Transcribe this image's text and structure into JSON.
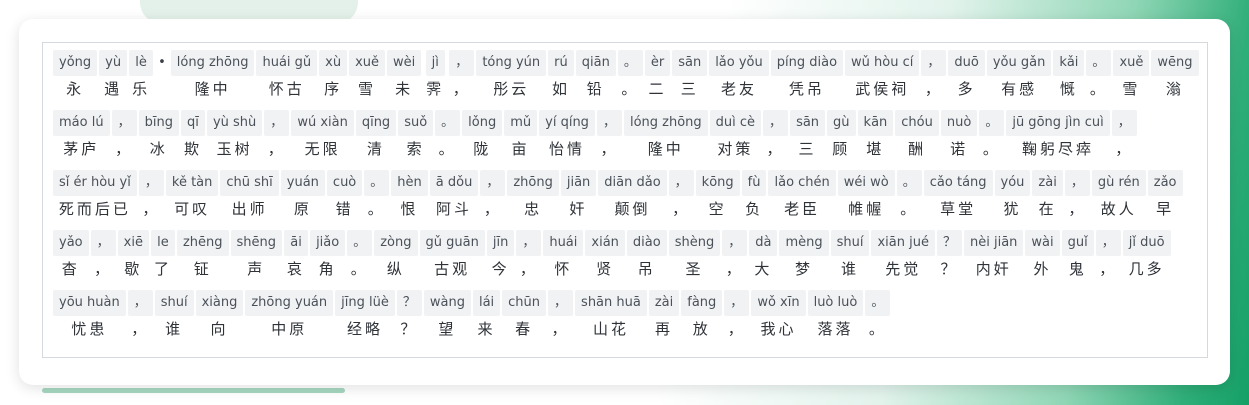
{
  "units": [
    {
      "py": "yǒng",
      "hz": "永"
    },
    {
      "py": "yù",
      "hz": "遇"
    },
    {
      "py": "lè",
      "hz": "乐"
    },
    {
      "py": "•",
      "hz": ""
    },
    {
      "py": "lóng zhōng",
      "hz": "隆中"
    },
    {
      "py": "huái gǔ",
      "hz": "怀古"
    },
    {
      "py": "xù",
      "hz": "序"
    },
    {
      "py": "xuě",
      "hz": "雪"
    },
    {
      "py": "wèi",
      "hz": "未"
    },
    {
      "py": "jì",
      "hz": "霁"
    },
    {
      "py": "，",
      "hz": "，"
    },
    {
      "py": "tóng yún",
      "hz": "彤云"
    },
    {
      "py": "rú",
      "hz": "如"
    },
    {
      "py": "qiān",
      "hz": "铅"
    },
    {
      "py": "。",
      "hz": "。"
    },
    {
      "py": "èr",
      "hz": "二"
    },
    {
      "py": "sān",
      "hz": "三"
    },
    {
      "py": "lǎo yǒu",
      "hz": "老友"
    },
    {
      "py": "píng diào",
      "hz": "凭吊"
    },
    {
      "py": "wǔ hòu cí",
      "hz": "武侯祠"
    },
    {
      "py": "，",
      "hz": "，"
    },
    {
      "py": "duō",
      "hz": "多"
    },
    {
      "py": "yǒu gǎn",
      "hz": "有感"
    },
    {
      "py": "kǎi",
      "hz": "慨"
    },
    {
      "py": "。",
      "hz": "。"
    },
    {
      "py": "xuě",
      "hz": "雪"
    },
    {
      "py": "wēng",
      "hz": "滃"
    },
    {
      "py": "máo lú",
      "hz": "茅庐"
    },
    {
      "py": "，",
      "hz": "，"
    },
    {
      "py": "bīng",
      "hz": "冰"
    },
    {
      "py": "qī",
      "hz": "欺"
    },
    {
      "py": "yù shù",
      "hz": "玉树"
    },
    {
      "py": "，",
      "hz": "，"
    },
    {
      "py": "wú xiàn",
      "hz": "无限"
    },
    {
      "py": "qīng",
      "hz": "清"
    },
    {
      "py": "suǒ",
      "hz": "索"
    },
    {
      "py": "。",
      "hz": "。"
    },
    {
      "py": "lǒng",
      "hz": "陇"
    },
    {
      "py": "mǔ",
      "hz": "亩"
    },
    {
      "py": "yí qíng",
      "hz": "怡情"
    },
    {
      "py": "，",
      "hz": "，"
    },
    {
      "py": "lóng zhōng",
      "hz": "隆中"
    },
    {
      "py": "duì cè",
      "hz": "对策"
    },
    {
      "py": "，",
      "hz": "，"
    },
    {
      "py": "sān",
      "hz": "三"
    },
    {
      "py": "gù",
      "hz": "顾"
    },
    {
      "py": "kān",
      "hz": "堪"
    },
    {
      "py": "chóu",
      "hz": "酬"
    },
    {
      "py": "nuò",
      "hz": "诺"
    },
    {
      "py": "。",
      "hz": "。"
    },
    {
      "py": "jū gōng jìn cuì",
      "hz": "鞠躬尽瘁"
    },
    {
      "py": "，",
      "hz": "，"
    },
    {
      "py": "sǐ ér hòu yǐ",
      "hz": "死而后已"
    },
    {
      "py": "，",
      "hz": "，"
    },
    {
      "py": "kě tàn",
      "hz": "可叹"
    },
    {
      "py": "chū shī",
      "hz": "出师"
    },
    {
      "py": "yuán",
      "hz": "原"
    },
    {
      "py": "cuò",
      "hz": "错"
    },
    {
      "py": "。",
      "hz": "。"
    },
    {
      "py": "hèn",
      "hz": "恨"
    },
    {
      "py": "ā dǒu",
      "hz": "阿斗"
    },
    {
      "py": "，",
      "hz": "，"
    },
    {
      "py": "zhōng",
      "hz": "忠"
    },
    {
      "py": "jiān",
      "hz": "奸"
    },
    {
      "py": "diān dǎo",
      "hz": "颠倒"
    },
    {
      "py": "，",
      "hz": "，"
    },
    {
      "py": "kōng",
      "hz": "空"
    },
    {
      "py": "fù",
      "hz": "负"
    },
    {
      "py": "lǎo chén",
      "hz": "老臣"
    },
    {
      "py": "wéi wò",
      "hz": "帷幄"
    },
    {
      "py": "。",
      "hz": "。"
    },
    {
      "py": "cǎo táng",
      "hz": "草堂"
    },
    {
      "py": "yóu",
      "hz": "犹"
    },
    {
      "py": "zài",
      "hz": "在"
    },
    {
      "py": "，",
      "hz": "，"
    },
    {
      "py": "gù rén",
      "hz": "故人"
    },
    {
      "py": "zǎo",
      "hz": "早"
    },
    {
      "py": "yǎo",
      "hz": "杳"
    },
    {
      "py": "，",
      "hz": "，"
    },
    {
      "py": "xiē",
      "hz": "歇"
    },
    {
      "py": "le",
      "hz": "了"
    },
    {
      "py": "zhēng",
      "hz": "钲"
    },
    {
      "py": "shēng",
      "hz": "声"
    },
    {
      "py": "āi",
      "hz": "哀"
    },
    {
      "py": "jiǎo",
      "hz": "角"
    },
    {
      "py": "。",
      "hz": "。"
    },
    {
      "py": "zòng",
      "hz": "纵"
    },
    {
      "py": "gǔ guān",
      "hz": "古观"
    },
    {
      "py": "jīn",
      "hz": "今"
    },
    {
      "py": "，",
      "hz": "，"
    },
    {
      "py": "huái",
      "hz": "怀"
    },
    {
      "py": "xián",
      "hz": "贤"
    },
    {
      "py": "diào",
      "hz": "吊"
    },
    {
      "py": "shèng",
      "hz": "圣"
    },
    {
      "py": "，",
      "hz": "，"
    },
    {
      "py": "dà",
      "hz": "大"
    },
    {
      "py": "mèng",
      "hz": "梦"
    },
    {
      "py": "shuí",
      "hz": "谁"
    },
    {
      "py": "xiān jué",
      "hz": "先觉"
    },
    {
      "py": "？",
      "hz": "？"
    },
    {
      "py": "nèi jiān",
      "hz": "内奸"
    },
    {
      "py": "wài",
      "hz": "外"
    },
    {
      "py": "guǐ",
      "hz": "鬼"
    },
    {
      "py": "，",
      "hz": "，"
    },
    {
      "py": "jǐ duō",
      "hz": "几多"
    },
    {
      "py": "yōu huàn",
      "hz": "忧患"
    },
    {
      "py": "，",
      "hz": "，"
    },
    {
      "py": "shuí",
      "hz": "谁"
    },
    {
      "py": "xiàng",
      "hz": "向"
    },
    {
      "py": "zhōng yuán",
      "hz": "中原"
    },
    {
      "py": "jīng lüè",
      "hz": "经略"
    },
    {
      "py": "？",
      "hz": "？"
    },
    {
      "py": "wàng",
      "hz": "望"
    },
    {
      "py": "lái",
      "hz": "来"
    },
    {
      "py": "chūn",
      "hz": "春"
    },
    {
      "py": "，",
      "hz": "，"
    },
    {
      "py": "shān huā",
      "hz": "山花"
    },
    {
      "py": "zài",
      "hz": "再"
    },
    {
      "py": "fàng",
      "hz": "放"
    },
    {
      "py": "，",
      "hz": "，"
    },
    {
      "py": "wǒ xīn",
      "hz": "我心"
    },
    {
      "py": "luò luò",
      "hz": "落落"
    },
    {
      "py": "。",
      "hz": "。"
    }
  ]
}
